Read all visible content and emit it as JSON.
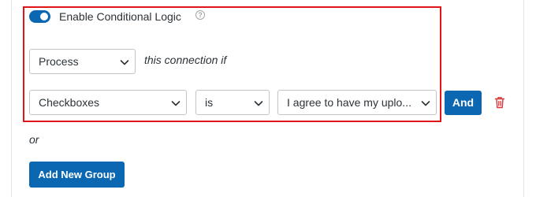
{
  "conditional_logic": {
    "toggle_label": "Enable Conditional Logic",
    "toggle_state": "on",
    "help_glyph": "?",
    "action_select": {
      "value": "Process"
    },
    "connector_text": "this connection if",
    "rule": {
      "field_select": {
        "value": "Checkboxes"
      },
      "operator_select": {
        "value": "is"
      },
      "value_select": {
        "value": "I agree to have my uplo..."
      },
      "and_button_label": "And"
    },
    "or_text": "or",
    "add_group_button_label": "Add New Group"
  },
  "colors": {
    "accent": "#0b67b2",
    "highlight_border": "#e0151a",
    "delete_icon": "#d63638"
  },
  "icons": {
    "help": "help-circle-icon",
    "select_arrow": "chevron-down-icon",
    "delete": "trash-icon"
  }
}
